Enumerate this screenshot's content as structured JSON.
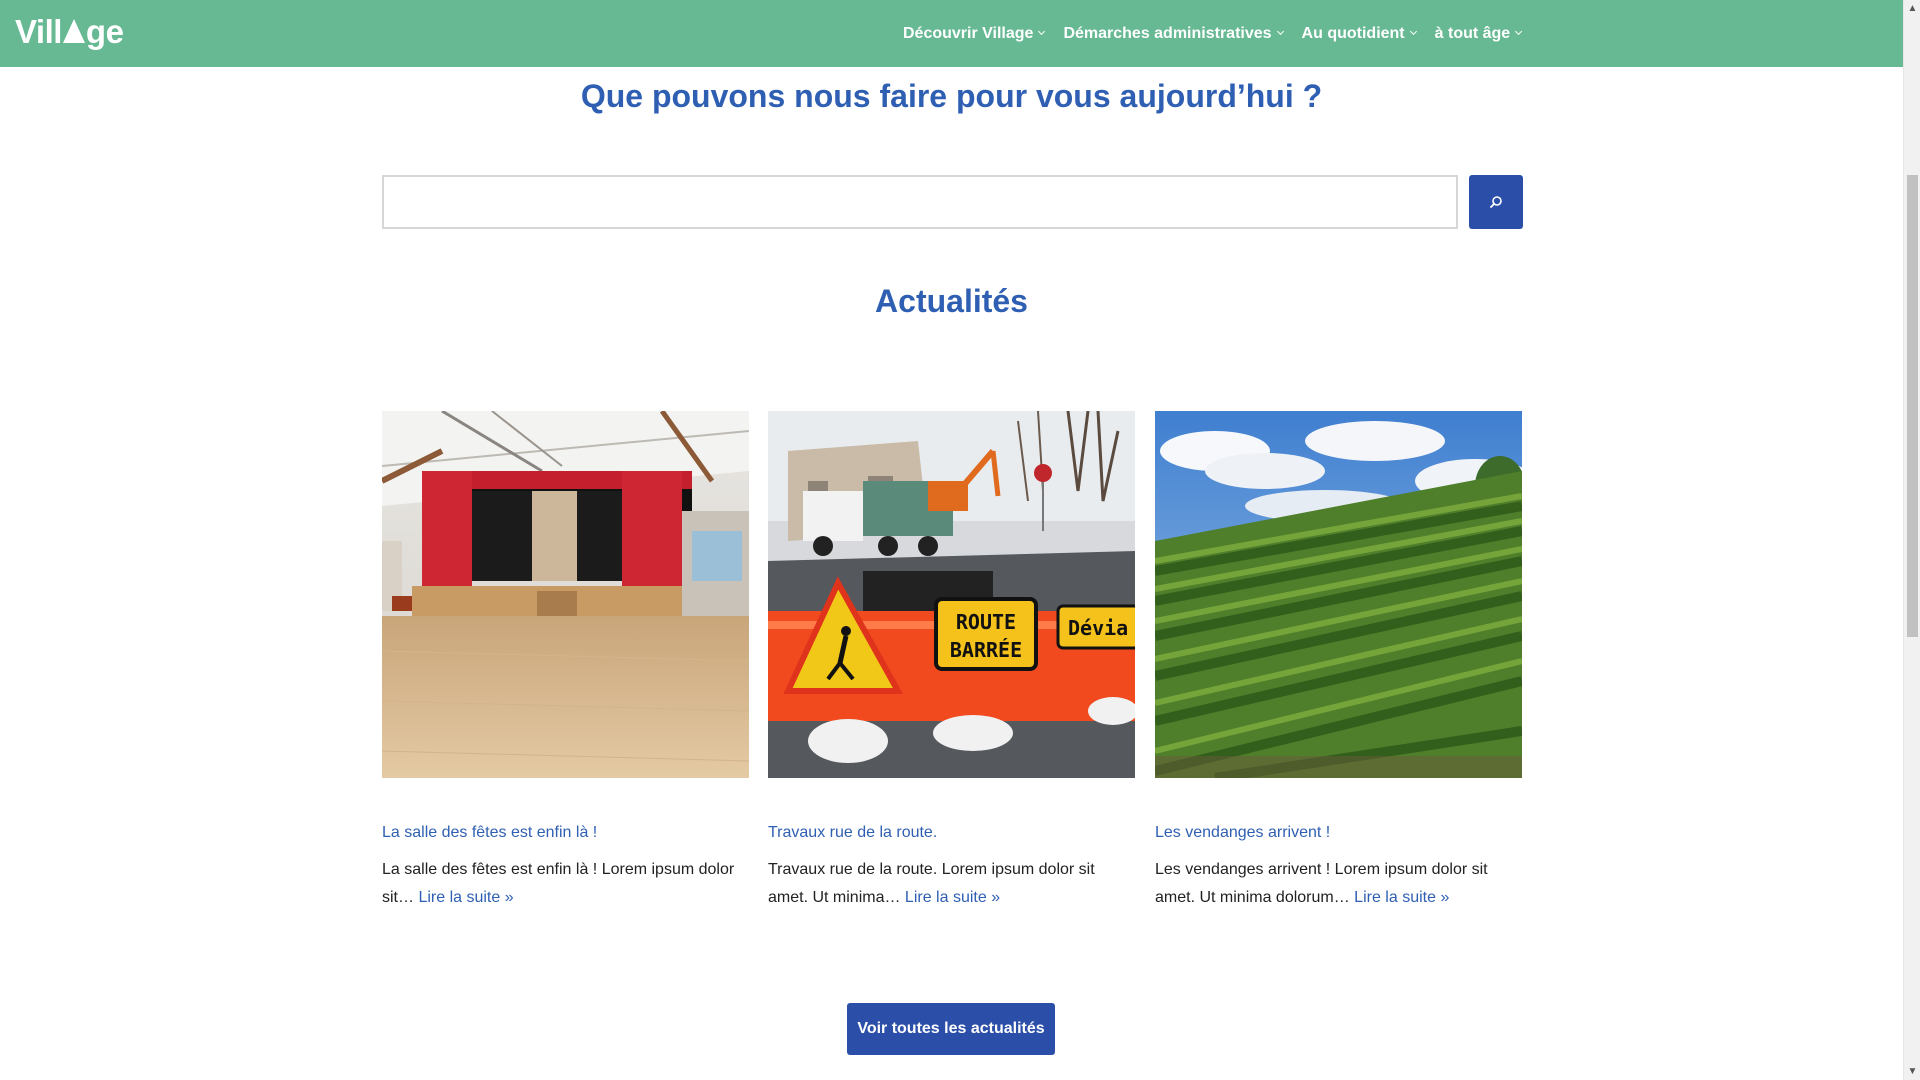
{
  "header": {
    "logo_left": "Vill",
    "logo_right": "ge",
    "nav": [
      {
        "label": "Découvrir Village"
      },
      {
        "label": "Démarches administratives"
      },
      {
        "label": "Au quotidient"
      },
      {
        "label": "à tout âge"
      }
    ]
  },
  "hero": {
    "title": "Que pouvons nous faire pour vous aujourd’hui ?"
  },
  "search": {
    "value": "",
    "placeholder": ""
  },
  "news": {
    "title": "Actualités",
    "items": [
      {
        "title": "La salle des fêtes est enfin là !",
        "excerpt": "La salle des fêtes est enfin là ! Lorem ipsum dolor sit…",
        "read_more": "Lire la suite »",
        "image": "community-hall-stage-image"
      },
      {
        "title": "Travaux rue de la route.",
        "excerpt": "Travaux rue de la route. Lorem ipsum dolor sit amet. Ut minima…",
        "read_more": "Lire la suite »",
        "image": "road-works-image",
        "sign_text_1": "ROUTE",
        "sign_text_2": "BARRÉE",
        "sign_text_3": "Dévia"
      },
      {
        "title": "Les vendanges arrivent !",
        "excerpt": "Les vendanges arrivent ! Lorem ipsum dolor sit amet. Ut minima dolorum…",
        "read_more": "Lire la suite »",
        "image": "vineyard-image"
      }
    ],
    "all_button": "Voir toutes les actualités"
  },
  "colors": {
    "header_bg": "#66b993",
    "heading_blue": "#2f5fb3",
    "button_blue": "#2b4fa8"
  }
}
